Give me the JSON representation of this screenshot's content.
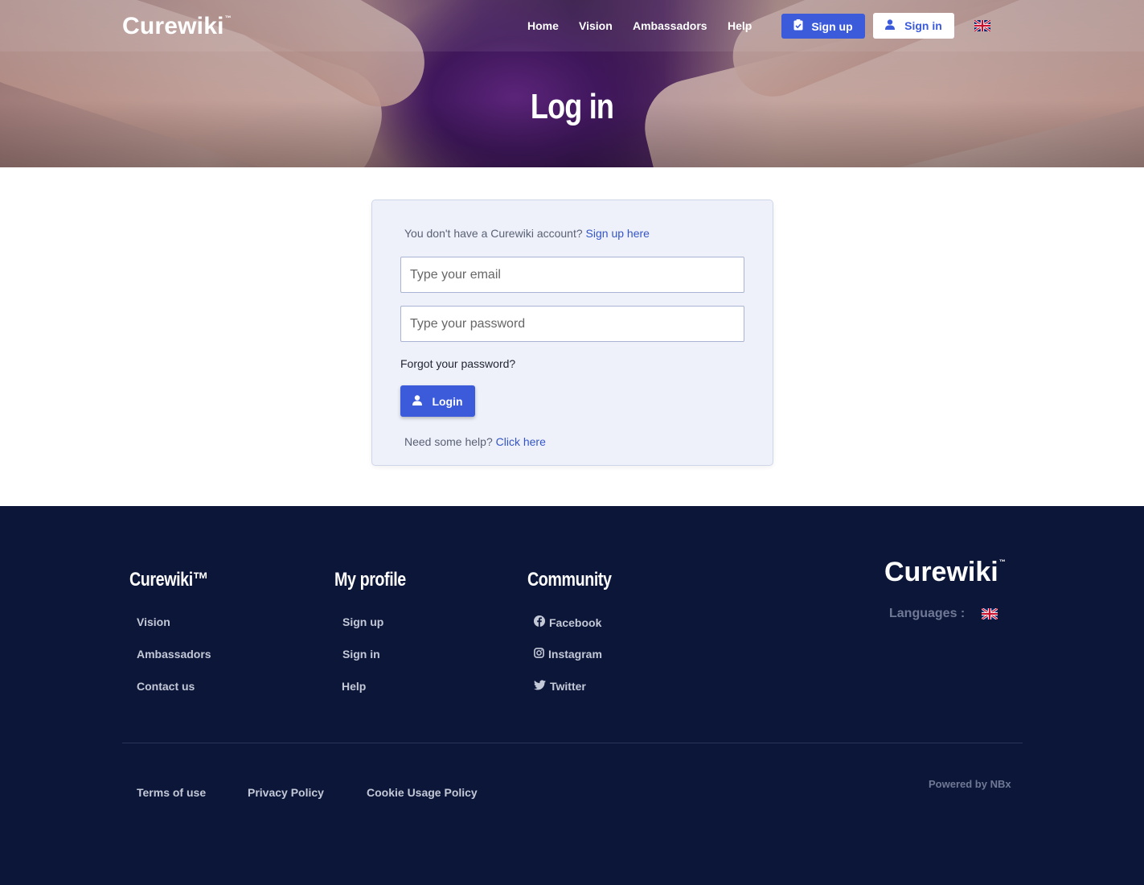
{
  "header": {
    "logo": "Curewiki",
    "logo_tm": "™",
    "nav": [
      "Home",
      "Vision",
      "Ambassadors",
      "Help"
    ],
    "signup_label": "Sign up",
    "signin_label": "Sign in",
    "language_flag": "uk-flag"
  },
  "hero": {
    "title": "Log in"
  },
  "login": {
    "no_account_text": "You don't have a Curewiki account?",
    "signup_link": "Sign up here",
    "email_placeholder": "Type your email",
    "password_placeholder": "Type your password",
    "forgot_password": "Forgot your password?",
    "login_button": "Login",
    "help_text": "Need some help?",
    "help_link": "Click here"
  },
  "footer": {
    "col1": {
      "title": "Curewiki™",
      "links": [
        "Vision",
        "Ambassadors",
        "Contact us"
      ]
    },
    "col2": {
      "title": "My profile",
      "links": [
        "Sign up",
        "Sign in",
        "Help"
      ]
    },
    "col3": {
      "title": "Community",
      "links": [
        "Facebook",
        "Instagram",
        "Twitter"
      ]
    },
    "logo": "Curewiki",
    "logo_tm": "™",
    "languages_label": "Languages :",
    "legal": [
      "Terms of use",
      "Privacy Policy",
      "Cookie Usage Policy"
    ],
    "powered_by": "Powered by NBx"
  },
  "colors": {
    "primary": "#3b5bdb",
    "footer_bg": "#0c1638",
    "card_bg": "#eef1fa"
  }
}
